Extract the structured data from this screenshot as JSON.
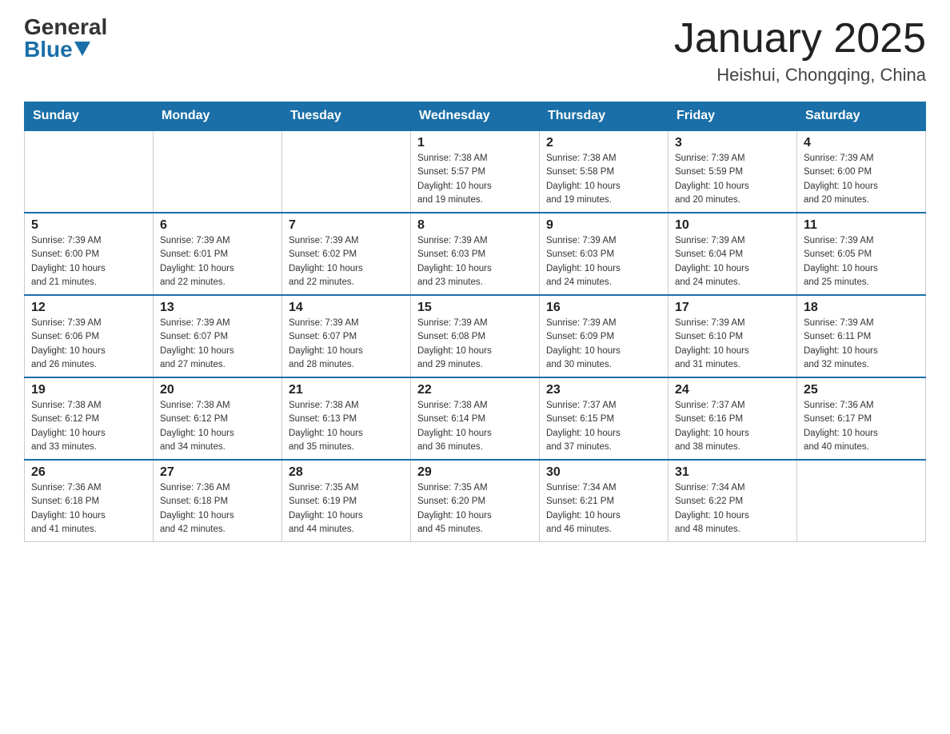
{
  "header": {
    "logo_general": "General",
    "logo_blue": "Blue",
    "title": "January 2025",
    "subtitle": "Heishui, Chongqing, China"
  },
  "weekdays": [
    "Sunday",
    "Monday",
    "Tuesday",
    "Wednesday",
    "Thursday",
    "Friday",
    "Saturday"
  ],
  "weeks": [
    [
      {
        "day": "",
        "info": ""
      },
      {
        "day": "",
        "info": ""
      },
      {
        "day": "",
        "info": ""
      },
      {
        "day": "1",
        "info": "Sunrise: 7:38 AM\nSunset: 5:57 PM\nDaylight: 10 hours\nand 19 minutes."
      },
      {
        "day": "2",
        "info": "Sunrise: 7:38 AM\nSunset: 5:58 PM\nDaylight: 10 hours\nand 19 minutes."
      },
      {
        "day": "3",
        "info": "Sunrise: 7:39 AM\nSunset: 5:59 PM\nDaylight: 10 hours\nand 20 minutes."
      },
      {
        "day": "4",
        "info": "Sunrise: 7:39 AM\nSunset: 6:00 PM\nDaylight: 10 hours\nand 20 minutes."
      }
    ],
    [
      {
        "day": "5",
        "info": "Sunrise: 7:39 AM\nSunset: 6:00 PM\nDaylight: 10 hours\nand 21 minutes."
      },
      {
        "day": "6",
        "info": "Sunrise: 7:39 AM\nSunset: 6:01 PM\nDaylight: 10 hours\nand 22 minutes."
      },
      {
        "day": "7",
        "info": "Sunrise: 7:39 AM\nSunset: 6:02 PM\nDaylight: 10 hours\nand 22 minutes."
      },
      {
        "day": "8",
        "info": "Sunrise: 7:39 AM\nSunset: 6:03 PM\nDaylight: 10 hours\nand 23 minutes."
      },
      {
        "day": "9",
        "info": "Sunrise: 7:39 AM\nSunset: 6:03 PM\nDaylight: 10 hours\nand 24 minutes."
      },
      {
        "day": "10",
        "info": "Sunrise: 7:39 AM\nSunset: 6:04 PM\nDaylight: 10 hours\nand 24 minutes."
      },
      {
        "day": "11",
        "info": "Sunrise: 7:39 AM\nSunset: 6:05 PM\nDaylight: 10 hours\nand 25 minutes."
      }
    ],
    [
      {
        "day": "12",
        "info": "Sunrise: 7:39 AM\nSunset: 6:06 PM\nDaylight: 10 hours\nand 26 minutes."
      },
      {
        "day": "13",
        "info": "Sunrise: 7:39 AM\nSunset: 6:07 PM\nDaylight: 10 hours\nand 27 minutes."
      },
      {
        "day": "14",
        "info": "Sunrise: 7:39 AM\nSunset: 6:07 PM\nDaylight: 10 hours\nand 28 minutes."
      },
      {
        "day": "15",
        "info": "Sunrise: 7:39 AM\nSunset: 6:08 PM\nDaylight: 10 hours\nand 29 minutes."
      },
      {
        "day": "16",
        "info": "Sunrise: 7:39 AM\nSunset: 6:09 PM\nDaylight: 10 hours\nand 30 minutes."
      },
      {
        "day": "17",
        "info": "Sunrise: 7:39 AM\nSunset: 6:10 PM\nDaylight: 10 hours\nand 31 minutes."
      },
      {
        "day": "18",
        "info": "Sunrise: 7:39 AM\nSunset: 6:11 PM\nDaylight: 10 hours\nand 32 minutes."
      }
    ],
    [
      {
        "day": "19",
        "info": "Sunrise: 7:38 AM\nSunset: 6:12 PM\nDaylight: 10 hours\nand 33 minutes."
      },
      {
        "day": "20",
        "info": "Sunrise: 7:38 AM\nSunset: 6:12 PM\nDaylight: 10 hours\nand 34 minutes."
      },
      {
        "day": "21",
        "info": "Sunrise: 7:38 AM\nSunset: 6:13 PM\nDaylight: 10 hours\nand 35 minutes."
      },
      {
        "day": "22",
        "info": "Sunrise: 7:38 AM\nSunset: 6:14 PM\nDaylight: 10 hours\nand 36 minutes."
      },
      {
        "day": "23",
        "info": "Sunrise: 7:37 AM\nSunset: 6:15 PM\nDaylight: 10 hours\nand 37 minutes."
      },
      {
        "day": "24",
        "info": "Sunrise: 7:37 AM\nSunset: 6:16 PM\nDaylight: 10 hours\nand 38 minutes."
      },
      {
        "day": "25",
        "info": "Sunrise: 7:36 AM\nSunset: 6:17 PM\nDaylight: 10 hours\nand 40 minutes."
      }
    ],
    [
      {
        "day": "26",
        "info": "Sunrise: 7:36 AM\nSunset: 6:18 PM\nDaylight: 10 hours\nand 41 minutes."
      },
      {
        "day": "27",
        "info": "Sunrise: 7:36 AM\nSunset: 6:18 PM\nDaylight: 10 hours\nand 42 minutes."
      },
      {
        "day": "28",
        "info": "Sunrise: 7:35 AM\nSunset: 6:19 PM\nDaylight: 10 hours\nand 44 minutes."
      },
      {
        "day": "29",
        "info": "Sunrise: 7:35 AM\nSunset: 6:20 PM\nDaylight: 10 hours\nand 45 minutes."
      },
      {
        "day": "30",
        "info": "Sunrise: 7:34 AM\nSunset: 6:21 PM\nDaylight: 10 hours\nand 46 minutes."
      },
      {
        "day": "31",
        "info": "Sunrise: 7:34 AM\nSunset: 6:22 PM\nDaylight: 10 hours\nand 48 minutes."
      },
      {
        "day": "",
        "info": ""
      }
    ]
  ]
}
